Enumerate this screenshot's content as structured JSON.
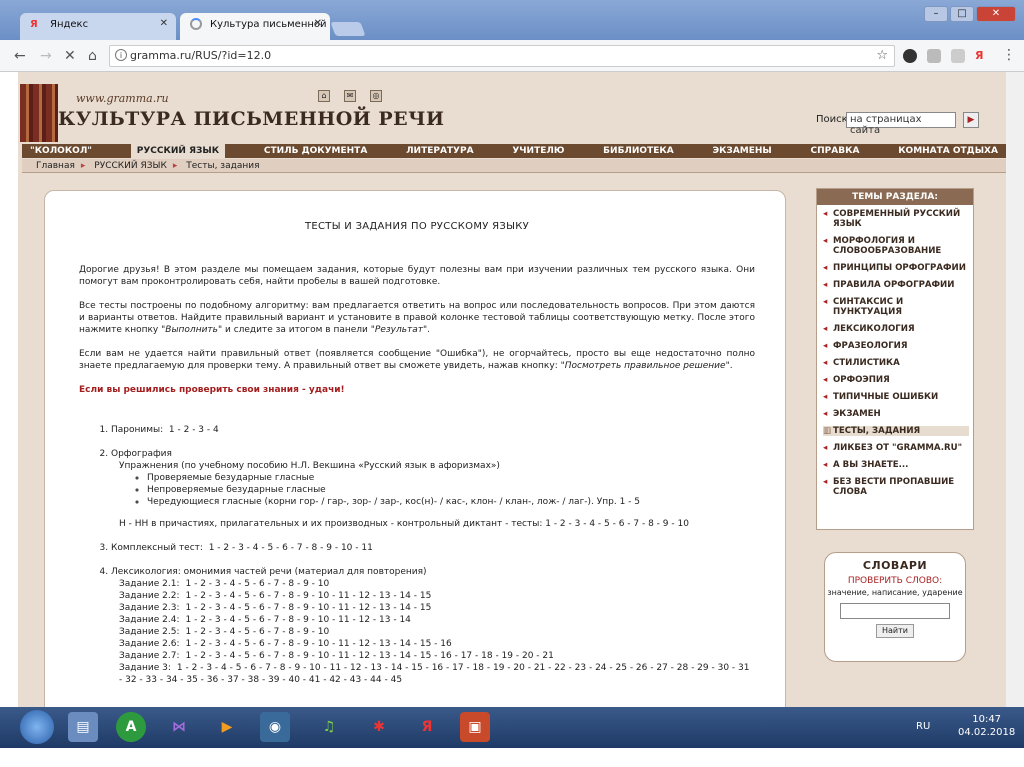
{
  "browser": {
    "tabs": [
      {
        "title": "Яндекс",
        "icon": "Я"
      },
      {
        "title": "Культура письменной р",
        "icon": "loading"
      }
    ],
    "url": "gramma.ru/RUS/?id=12.0",
    "window_buttons": [
      "–",
      "□",
      "✕"
    ]
  },
  "header": {
    "site_url": "www.gramma.ru",
    "title": "КУЛЬТУРА ПИСЬМЕННОЙ РЕЧИ",
    "search_label": "Поиск",
    "search_value": "на страницах сайта"
  },
  "nav": [
    "\"КОЛОКОЛ\"",
    "РУССКИЙ ЯЗЫК",
    "СТИЛЬ ДОКУМЕНТА",
    "ЛИТЕРАТУРА",
    "УЧИТЕЛЮ",
    "БИБЛИОТЕКА",
    "ЭКЗАМЕНЫ",
    "СПРАВКА",
    "КОМНАТА ОТДЫХА"
  ],
  "breadcrumbs": [
    "Главная",
    "РУССКИЙ ЯЗЫК",
    "Тесты, задания"
  ],
  "content": {
    "title": "ТЕСТЫ И ЗАДАНИЯ ПО РУССКОМУ ЯЗЫКУ",
    "p1": "Дорогие друзья! В этом разделе мы помещаем задания, которые будут полезны вам при изучении различных тем русского языка. Они помогут вам проконтролировать себя, найти пробелы в вашей подготовке.",
    "p2a": "Все тесты построены по подобному алгоритму: вам предлагается ответить на вопрос или последовательность вопросов. При этом даются и варианты ответов. Найдите правильный вариант и установите в правой колонке тестовой таблицы соответствующую метку. После этого нажмите кнопку \"",
    "p2b": "Выполнить",
    "p2c": "\" и следите за итогом в панели \"",
    "p2d": "Результат",
    "p2e": "\".",
    "p3a": "Если вам не удается найти правильный ответ (появляется сообщение \"Ошибка\"), не огорчайтесь, просто вы еще недостаточно полно знаете предлагаемую для проверки тему. А правильный ответ вы сможете увидеть, нажав кнопку: \"",
    "p3b": "Посмотреть правильное решение",
    "p3c": "\".",
    "luck": "Если вы решились проверить свои знания - удачи!",
    "item1_label": "Паронимы:",
    "item1_nums": "1 - 2 - 3 - 4",
    "item2_label": "Орфография",
    "item2_sub": "Упражнения (по учебному пособию Н.Л. Векшина «Русский язык в афоризмах»)",
    "item2_bullets": [
      "Проверяемые безударные гласные",
      "Непроверяемые безударные гласные",
      "Чередующиеся гласные (корни гор- / гар-, зор- / зар-, кос(н)- / кас-, клон- / клан-, лож- / лаг-). Упр. 1 - 5"
    ],
    "item2_nn": "Н - НН в причастиях, прилагательных и их производных - контрольный диктант - тесты: 1 - 2 - 3 - 4 - 5 - 6 - 7 - 8 - 9 - 10",
    "item3_label": "Комплексный тест:",
    "item3_nums": "1 - 2 - 3 - 4 - 5 - 6 - 7 - 8 - 9 - 10 - 11",
    "item4_label": "Лексикология: омонимия частей речи",
    "item4_note": "(материал для повторения)",
    "item4_rows": [
      {
        "label": "Задание 2.1:",
        "nums": "1 - 2 - 3 - 4 - 5 - 6 - 7 - 8 - 9 - 10"
      },
      {
        "label": "Задание 2.2:",
        "nums": "1 - 2 - 3 - 4 - 5 - 6 - 7 - 8 - 9 - 10 - 11 - 12 - 13 - 14 - 15"
      },
      {
        "label": "Задание 2.3:",
        "nums": "1 - 2 - 3 - 4 - 5 - 6 - 7 - 8 - 9 - 10 - 11 - 12 - 13 - 14 - 15"
      },
      {
        "label": "Задание 2.4:",
        "nums": "1 - 2 - 3 - 4 - 5 - 6 - 7 - 8 - 9 - 10 - 11 - 12 - 13 - 14"
      },
      {
        "label": "Задание 2.5:",
        "nums": "1 - 2 - 3 - 4 - 5 - 6 - 7 - 8 - 9 - 10"
      },
      {
        "label": "Задание 2.6:",
        "nums": "1 - 2 - 3 - 4 - 5 - 6 - 7 - 8 - 9 - 10 - 11 - 12 - 13 - 14 - 15 - 16"
      },
      {
        "label": "Задание 2.7:",
        "nums": "1 - 2 - 3 - 4 - 5 - 6 - 7 - 8 - 9 - 10 - 11 - 12 - 13 - 14 - 15 - 16 - 17 - 18 - 19 - 20 - 21"
      },
      {
        "label": "Задание 3:",
        "nums": "1 - 2 - 3 - 4 - 5 - 6 - 7 - 8 - 9 - 10 - 11 - 12 - 13 - 14 - 15 - 16 - 17 - 18 - 19 - 20 - 21 - 22 - 23 - 24 - 25 - 26 - 27 - 28 - 29 - 30 - 31 - 32 - 33 - 34 - 35 - 36 - 37 - 38 - 39 - 40 - 41 - 42 - 43 - 44 - 45"
      }
    ]
  },
  "sidebar": {
    "title": "ТЕМЫ РАЗДЕЛА:",
    "items": [
      "СОВРЕМЕННЫЙ РУССКИЙ ЯЗЫК",
      "МОРФОЛОГИЯ И СЛОВООБРАЗОВАНИЕ",
      "ПРИНЦИПЫ ОРФОГРАФИИ",
      "ПРАВИЛА ОРФОГРАФИИ",
      "СИНТАКСИС И ПУНКТУАЦИЯ",
      "ЛЕКСИКОЛОГИЯ",
      "ФРАЗЕОЛОГИЯ",
      "СТИЛИСТИКА",
      "ОРФОЭПИЯ",
      "ТИПИЧНЫЕ ОШИБКИ",
      "ЭКЗАМЕН",
      "ТЕСТЫ, ЗАДАНИЯ",
      "ЛИКБЕЗ ОТ \"GRAMMA.RU\"",
      "А ВЫ ЗНАЕТЕ...",
      "БЕЗ ВЕСТИ ПРОПАВШИЕ СЛОВА"
    ]
  },
  "dictionary": {
    "title": "СЛОВАРИ",
    "subtitle": "ПРОВЕРИТЬ СЛОВО:",
    "hint": "значение, написание, ударение",
    "button": "Найти"
  },
  "taskbar": {
    "lang": "RU",
    "time": "10:47",
    "date": "04.02.2018"
  }
}
